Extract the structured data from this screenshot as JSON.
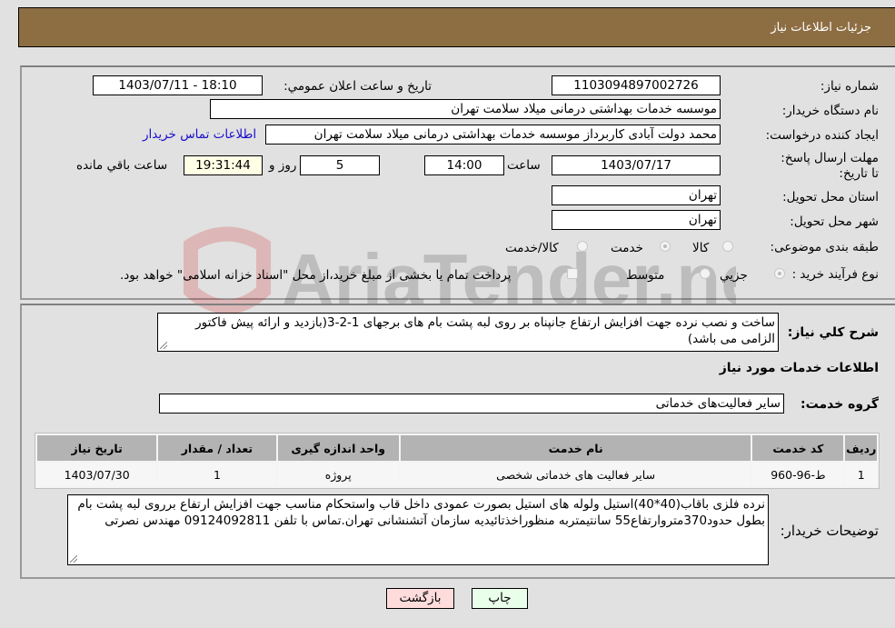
{
  "header": {
    "title": "جزئیات اطلاعات نیاز"
  },
  "form": {
    "need_number": {
      "label": "شماره نیاز:",
      "value": "1103094897002726"
    },
    "announce_datetime": {
      "label": "تاريخ و ساعت اعلان عمومي:",
      "value": "1403/07/11 - 18:10"
    },
    "buyer_org": {
      "label": "نام دستگاه خریدار:",
      "value": "موسسه خدمات بهداشتی درمانی میلاد سلامت تهران"
    },
    "requester": {
      "label": "ایجاد کننده درخواست:",
      "value": "محمد دولت آبادی کاربرداز موسسه خدمات بهداشتی درمانی میلاد سلامت تهران"
    },
    "buyer_contact_link": "اطلاعات تماس خریدار",
    "deadline": {
      "label": "مهلت ارسال پاسخ: تا تاریخ:",
      "date": "1403/07/17",
      "time_label": "ساعت",
      "time": "14:00",
      "days": "5",
      "days_label": "روز و",
      "remaining": "19:31:44",
      "remaining_label": "ساعت باقي مانده"
    },
    "province": {
      "label": "استان محل تحویل:",
      "value": "تهران"
    },
    "city": {
      "label": "شهر محل تحویل:",
      "value": "تهران"
    },
    "category": {
      "label": "طبقه بندی موضوعی:",
      "options": [
        "کالا",
        "خدمت",
        "کالا/خدمت"
      ],
      "selected": "خدمت"
    },
    "purchase_type": {
      "label": "نوع فرآیند خرید :",
      "options": [
        "جزيي",
        "متوسط"
      ],
      "selected": "جزيي",
      "treasury_note": "پرداخت تمام یا بخشی از مبلغ خرید،از محل \"اسناد خزانه اسلامی\" خواهد بود."
    }
  },
  "description": {
    "label": "شرح کلي نياز:",
    "value": "ساخت و نصب نرده جهت افزایش ارتفاع جانپناه بر روی لبه پشت بام های برجهای 1-2-3(بازدید و ارائه پیش فاکتور الزامی می باشد)"
  },
  "services": {
    "section_title": "اطلاعات خدمات مورد نياز",
    "group_label": "گروه خدمت:",
    "group_value": "سایر فعالیت‌های خدماتی",
    "table": {
      "headers": [
        "ردیف",
        "کد خدمت",
        "نام خدمت",
        "واحد اندازه گیری",
        "تعداد / مقدار",
        "تاریخ نیاز"
      ],
      "rows": [
        [
          "1",
          "ط-96-960",
          "سایر فعالیت های خدماتی شخصی",
          "پروژه",
          "1",
          "1403/07/30"
        ]
      ]
    }
  },
  "buyer_notes": {
    "label": "توضیحات خریدار:",
    "value": "نرده فلزی باقاب(40*40)استیل ولوله های استیل بصورت عمودی داخل قاب واستحکام مناسب جهت افزایش ارتفاع برروی لبه پشت بام بطول حدود370متروارتفاع55 سانتیمتربه منظوراخذتائیدیه سازمان آتشنشانی تهران.تماس با تلفن 09124092811 مهندس نصرتی"
  },
  "buttons": {
    "print": "چاپ",
    "back": "بازگشت"
  },
  "watermark": {
    "text": "AriaTender.neT"
  }
}
